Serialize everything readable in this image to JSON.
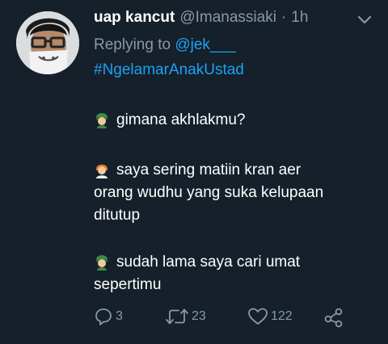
{
  "tweet": {
    "display_name": "uap kancut",
    "handle": "@Imanassiaki",
    "separator": "·",
    "time": "1h",
    "replying_prefix": "Replying to ",
    "replying_to": "@jek___",
    "hashtag": "#NgelamarAnakUstad",
    "lines": {
      "q1": "gimana akhlakmu?",
      "a1_line1": "saya sering matiin kran aer",
      "a1_line2": "orang wudhu yang suka kelupaan",
      "a1_line3": "ditutup",
      "q2_line1": "sudah lama saya cari umat",
      "q2_line2": "sepertimu"
    },
    "emoji": {
      "q1": "man-with-turban-emoji",
      "a1": "person-emoji",
      "q2": "man-with-turban-emoji"
    }
  },
  "actions": {
    "reply_count": "3",
    "retweet_count": "23",
    "like_count": "122",
    "icons": {
      "reply": "reply-icon",
      "retweet": "retweet-icon",
      "like": "heart-icon",
      "share": "share-icon",
      "more": "chevron-down-icon"
    }
  },
  "colors": {
    "background": "#15202b",
    "text": "#ffffff",
    "muted": "#8899a6",
    "link": "#1da1f2"
  }
}
